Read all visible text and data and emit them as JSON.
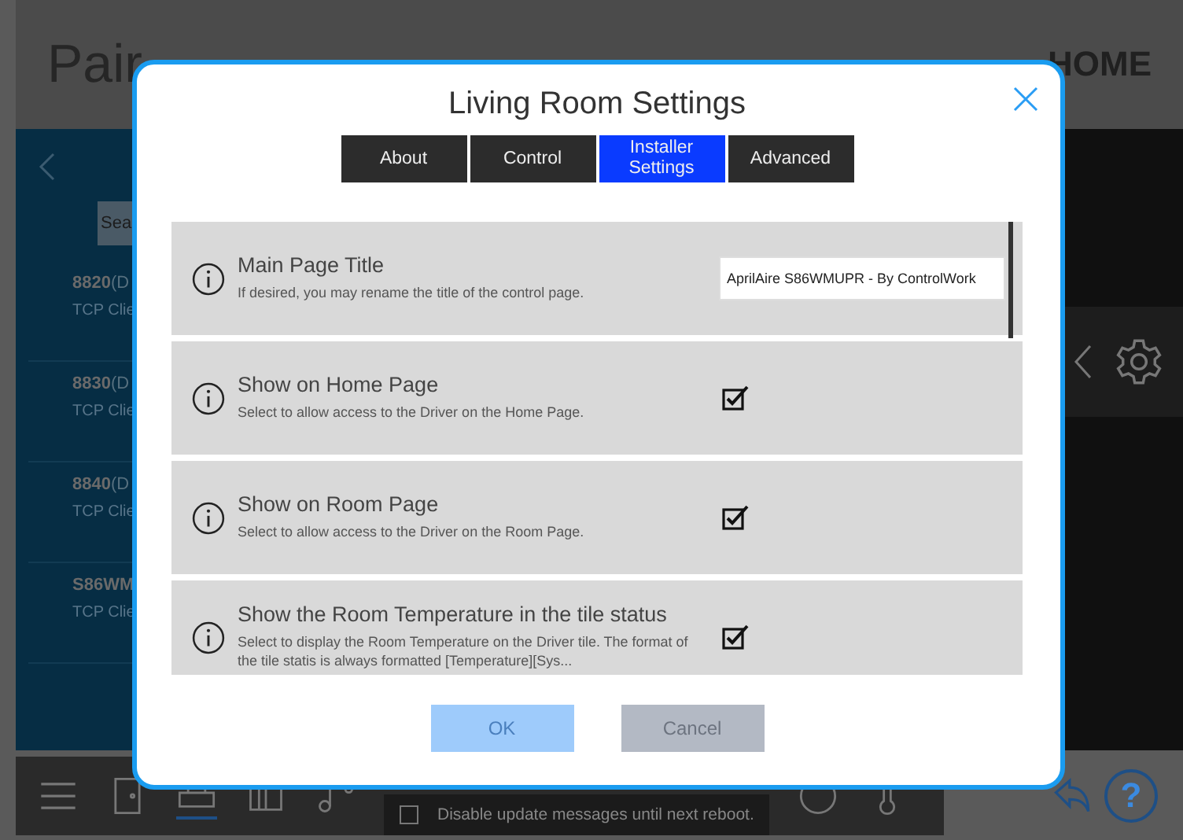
{
  "background": {
    "page_title": "Pair",
    "brand": "HOME",
    "search": {
      "placeholder": "Sea"
    },
    "devices": [
      {
        "name": "8820",
        "model": "(D",
        "protocol": "TCP Clie"
      },
      {
        "name": "8830",
        "model": "(D",
        "protocol": "TCP Clie"
      },
      {
        "name": "8840",
        "model": "(D",
        "protocol": "TCP Clie"
      },
      {
        "name": "S86WM",
        "protocol": "TCP Clie"
      }
    ],
    "notice": {
      "text": "Disable update messages until next reboot.",
      "checked": false
    },
    "help_label": "?"
  },
  "dialog": {
    "title": "Living Room Settings",
    "tabs": [
      {
        "label": "About",
        "selected": false
      },
      {
        "label": "Control",
        "selected": false
      },
      {
        "label": "Installer Settings",
        "selected": true
      },
      {
        "label": "Advanced",
        "selected": false
      }
    ],
    "settings": [
      {
        "kind": "text",
        "title": "Main Page Title",
        "description": "If desired, you may rename the title of the control page.",
        "value": "AprilAire S86WMUPR - By ControlWork"
      },
      {
        "kind": "checkbox",
        "title": "Show on Home Page",
        "description": "Select to allow access to the Driver on the Home Page.",
        "checked": true
      },
      {
        "kind": "checkbox",
        "title": "Show on Room Page",
        "description": "Select to allow access to the Driver on the Room Page.",
        "checked": true
      },
      {
        "kind": "checkbox",
        "title": "Show the Room Temperature in the tile status",
        "description": "Select to display the  Room Temperature on the Driver tile. The format of the tile statis is always formatted [Temperature][Sys...",
        "checked": true
      }
    ],
    "buttons": [
      {
        "label": "OK",
        "kind": "ok",
        "disabled": true
      },
      {
        "label": "Cancel",
        "kind": "cancel",
        "disabled": true
      }
    ]
  }
}
